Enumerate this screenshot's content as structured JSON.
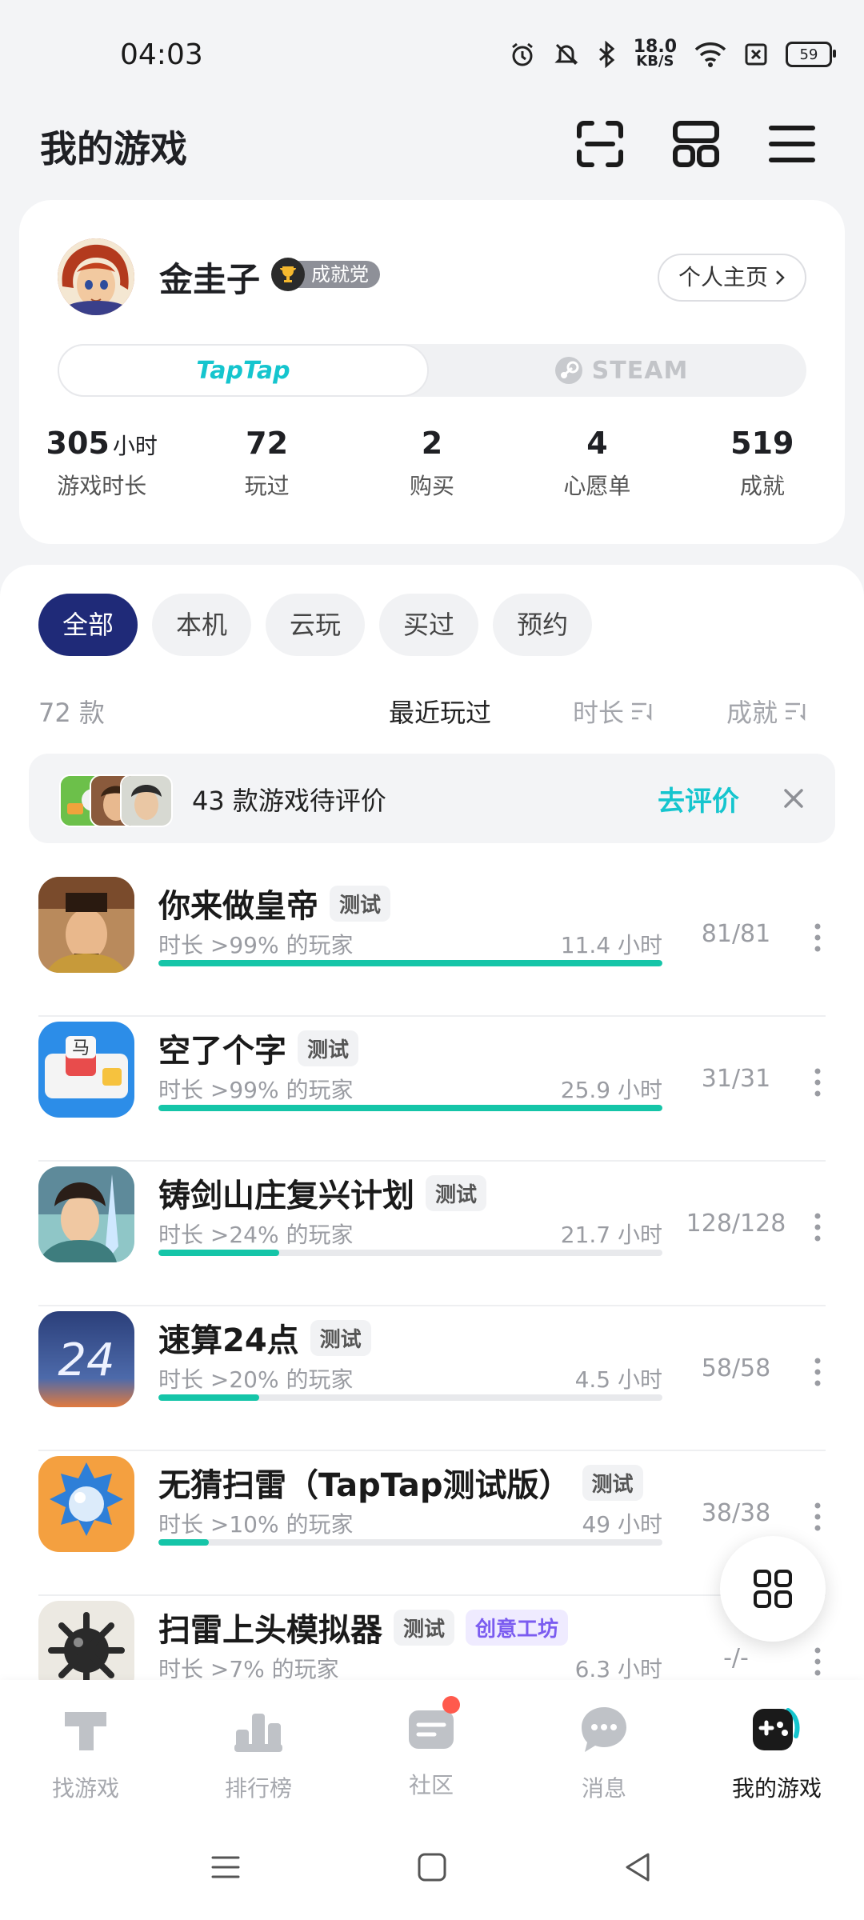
{
  "status_bar": {
    "time": "04:03",
    "speed_value": "18.0",
    "speed_unit": "KB/S",
    "battery": "59"
  },
  "header": {
    "title": "我的游戏"
  },
  "profile": {
    "username": "金圭子",
    "badge": "成就党",
    "homepage_label": "个人主页",
    "platform_tabs": [
      "TapTap",
      "STEAM"
    ],
    "stats": [
      {
        "value": "305",
        "unit": "小时",
        "label": "游戏时长"
      },
      {
        "value": "72",
        "unit": "",
        "label": "玩过"
      },
      {
        "value": "2",
        "unit": "",
        "label": "购买"
      },
      {
        "value": "4",
        "unit": "",
        "label": "心愿单"
      },
      {
        "value": "519",
        "unit": "",
        "label": "成就"
      }
    ]
  },
  "filters": [
    "全部",
    "本机",
    "云玩",
    "买过",
    "预约"
  ],
  "list_header": {
    "count": "72 款",
    "sort_recent": "最近玩过",
    "sort_duration": "时长",
    "sort_achievement": "成就"
  },
  "review_banner": {
    "text": "43 款游戏待评价",
    "action": "去评价"
  },
  "games": [
    {
      "name": "你来做皇帝",
      "tags": [
        "测试"
      ],
      "percentile": "时长 >99% 的玩家",
      "hours": "11.4 小时",
      "achievements": "81/81",
      "progress": 1.0
    },
    {
      "name": "空了个字",
      "tags": [
        "测试"
      ],
      "percentile": "时长 >99% 的玩家",
      "hours": "25.9 小时",
      "achievements": "31/31",
      "progress": 1.0
    },
    {
      "name": "铸剑山庄复兴计划",
      "tags": [
        "测试"
      ],
      "percentile": "时长 >24% 的玩家",
      "hours": "21.7 小时",
      "achievements": "128/128",
      "progress": 0.24
    },
    {
      "name": "速算24点",
      "tags": [
        "测试"
      ],
      "percentile": "时长 >20% 的玩家",
      "hours": "4.5 小时",
      "achievements": "58/58",
      "progress": 0.2
    },
    {
      "name": "无猜扫雷（TapTap测试版）",
      "tags": [
        "测试"
      ],
      "percentile": "时长 >10% 的玩家",
      "hours": "49 小时",
      "achievements": "38/38",
      "progress": 0.1
    },
    {
      "name": "扫雷上头模拟器",
      "tags": [
        "测试",
        "创意工坊"
      ],
      "percentile": "时长 >7% 的玩家",
      "hours": "6.3 小时",
      "achievements": "-/-",
      "progress": 0.07
    }
  ],
  "bottom_nav": [
    {
      "label": "找游戏",
      "icon": "taptap-logo-icon"
    },
    {
      "label": "排行榜",
      "icon": "ranking-icon"
    },
    {
      "label": "社区",
      "icon": "community-icon"
    },
    {
      "label": "消息",
      "icon": "message-icon"
    },
    {
      "label": "我的游戏",
      "icon": "gamepad-icon"
    }
  ],
  "colors": {
    "accent": "#15C5CE",
    "chip_active": "#1F2A78",
    "progress": "#15C5A8",
    "notification": "#FF5A4D"
  }
}
